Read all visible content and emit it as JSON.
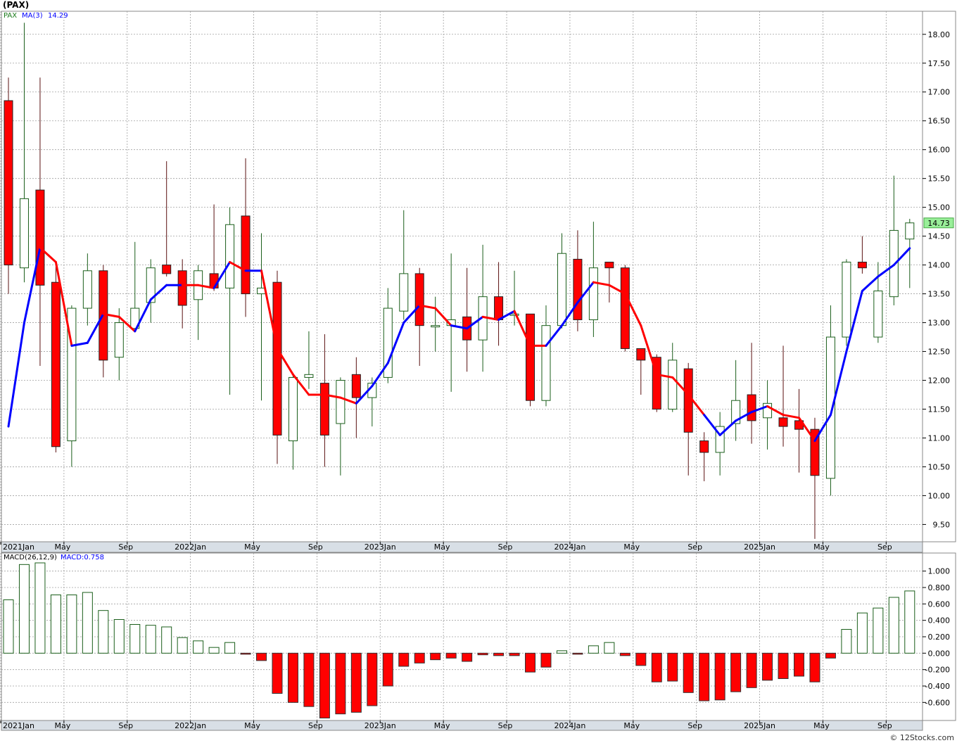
{
  "title": "(PAX)",
  "credit": "© 12Stocks.com",
  "price_legend": {
    "symbol": "PAX",
    "ma_label": "MA(3)",
    "ma_value": "14.29"
  },
  "macd_legend": {
    "label": "MACD(26,12,9)",
    "value_label": "MACD:0.758"
  },
  "last_price_label": "14.73",
  "colors": {
    "up_body_stroke": "#1a5e1a",
    "down_body": "#ff0000",
    "ma_up": "#0000ff",
    "ma_down": "#ff0000",
    "grid": "#a0a0a0",
    "axis_band": "#d8dfe6",
    "last_price_bg": "#99ee99"
  },
  "x_axis_labels": [
    "2021Jan",
    "May",
    "Sep",
    "2022Jan",
    "May",
    "Sep",
    "2023Jan",
    "May",
    "Sep",
    "2024Jan",
    "May",
    "Sep",
    "2025Jan",
    "May",
    "Sep"
  ],
  "price_axis": {
    "ticks": [
      "18.00",
      "17.50",
      "17.00",
      "16.50",
      "16.00",
      "15.50",
      "15.00",
      "14.50",
      "14.00",
      "13.50",
      "13.00",
      "12.50",
      "12.00",
      "11.50",
      "11.00",
      "10.50",
      "10.00",
      "9.50"
    ],
    "min": 9.2,
    "max": 18.4
  },
  "macd_axis": {
    "ticks": [
      "1.000",
      "0.800",
      "0.600",
      "0.400",
      "0.200",
      "0.000",
      "-0.200",
      "-0.400",
      "-0.600"
    ],
    "min": -0.82,
    "max": 1.22
  },
  "chart_data": [
    {
      "type": "candlestick",
      "title": "(PAX)",
      "x_labels": [
        "2021Jan",
        "May",
        "Sep",
        "2022Jan",
        "May",
        "Sep",
        "2023Jan",
        "May",
        "Sep",
        "2024Jan",
        "May",
        "Sep",
        "2025Jan",
        "May",
        "Sep"
      ],
      "ylim": [
        9.2,
        18.4
      ],
      "candles": [
        {
          "o": 16.85,
          "h": 17.25,
          "l": 13.5,
          "c": 14.0
        },
        {
          "o": 13.95,
          "h": 18.2,
          "l": 13.7,
          "c": 15.15
        },
        {
          "o": 15.3,
          "h": 17.25,
          "l": 12.25,
          "c": 13.65
        },
        {
          "o": 13.7,
          "h": 14.05,
          "l": 10.75,
          "c": 10.85
        },
        {
          "o": 10.95,
          "h": 13.3,
          "l": 10.5,
          "c": 13.25
        },
        {
          "o": 13.25,
          "h": 14.2,
          "l": 12.95,
          "c": 13.9
        },
        {
          "o": 13.9,
          "h": 14.0,
          "l": 12.05,
          "c": 12.35
        },
        {
          "o": 12.4,
          "h": 13.25,
          "l": 12.0,
          "c": 13.0
        },
        {
          "o": 12.9,
          "h": 14.4,
          "l": 12.85,
          "c": 13.25
        },
        {
          "o": 13.35,
          "h": 14.1,
          "l": 13.0,
          "c": 13.95
        },
        {
          "o": 14.0,
          "h": 15.8,
          "l": 13.8,
          "c": 13.85
        },
        {
          "o": 13.9,
          "h": 14.1,
          "l": 12.9,
          "c": 13.3
        },
        {
          "o": 13.4,
          "h": 14.0,
          "l": 12.7,
          "c": 13.9
        },
        {
          "o": 13.85,
          "h": 15.05,
          "l": 13.55,
          "c": 13.6
        },
        {
          "o": 13.6,
          "h": 15.0,
          "l": 11.75,
          "c": 14.7
        },
        {
          "o": 14.85,
          "h": 15.85,
          "l": 13.1,
          "c": 13.5
        },
        {
          "o": 13.5,
          "h": 14.55,
          "l": 11.65,
          "c": 13.6
        },
        {
          "o": 13.7,
          "h": 13.9,
          "l": 10.55,
          "c": 11.05
        },
        {
          "o": 10.95,
          "h": 12.1,
          "l": 10.45,
          "c": 12.05
        },
        {
          "o": 12.05,
          "h": 12.85,
          "l": 11.85,
          "c": 12.1
        },
        {
          "o": 11.95,
          "h": 12.8,
          "l": 10.5,
          "c": 11.05
        },
        {
          "o": 11.25,
          "h": 12.05,
          "l": 10.35,
          "c": 12.0
        },
        {
          "o": 12.1,
          "h": 12.4,
          "l": 11.0,
          "c": 11.7
        },
        {
          "o": 11.7,
          "h": 12.05,
          "l": 11.2,
          "c": 11.95
        },
        {
          "o": 12.05,
          "h": 13.6,
          "l": 11.95,
          "c": 13.25
        },
        {
          "o": 13.2,
          "h": 14.95,
          "l": 13.05,
          "c": 13.85
        },
        {
          "o": 13.85,
          "h": 13.95,
          "l": 12.25,
          "c": 12.95
        },
        {
          "o": 12.95,
          "h": 13.45,
          "l": 12.5,
          "c": 12.95
        },
        {
          "o": 12.95,
          "h": 14.2,
          "l": 11.8,
          "c": 13.05
        },
        {
          "o": 13.1,
          "h": 13.95,
          "l": 12.15,
          "c": 12.7
        },
        {
          "o": 12.7,
          "h": 14.35,
          "l": 12.15,
          "c": 13.45
        },
        {
          "o": 13.45,
          "h": 14.05,
          "l": 12.6,
          "c": 13.05
        },
        {
          "o": 13.15,
          "h": 13.9,
          "l": 12.95,
          "c": 13.15
        },
        {
          "o": 13.15,
          "h": 13.15,
          "l": 11.55,
          "c": 11.65
        },
        {
          "o": 11.65,
          "h": 13.3,
          "l": 11.55,
          "c": 12.95
        },
        {
          "o": 12.95,
          "h": 14.55,
          "l": 12.9,
          "c": 14.2
        },
        {
          "o": 14.1,
          "h": 14.6,
          "l": 12.85,
          "c": 13.05
        },
        {
          "o": 13.05,
          "h": 14.75,
          "l": 12.75,
          "c": 13.95
        },
        {
          "o": 14.05,
          "h": 14.05,
          "l": 13.35,
          "c": 13.95
        },
        {
          "o": 13.95,
          "h": 14.0,
          "l": 12.5,
          "c": 12.55
        },
        {
          "o": 12.55,
          "h": 12.5,
          "l": 11.75,
          "c": 12.35
        },
        {
          "o": 12.4,
          "h": 12.45,
          "l": 11.45,
          "c": 11.5
        },
        {
          "o": 11.5,
          "h": 12.65,
          "l": 11.45,
          "c": 12.35
        },
        {
          "o": 12.2,
          "h": 12.3,
          "l": 10.35,
          "c": 11.1
        },
        {
          "o": 10.95,
          "h": 11.1,
          "l": 10.25,
          "c": 10.75
        },
        {
          "o": 10.75,
          "h": 11.45,
          "l": 10.35,
          "c": 11.2
        },
        {
          "o": 11.25,
          "h": 12.35,
          "l": 10.95,
          "c": 11.65
        },
        {
          "o": 11.75,
          "h": 12.65,
          "l": 10.9,
          "c": 11.3
        },
        {
          "o": 11.35,
          "h": 12.0,
          "l": 10.8,
          "c": 11.6
        },
        {
          "o": 11.35,
          "h": 12.6,
          "l": 10.85,
          "c": 11.2
        },
        {
          "o": 11.3,
          "h": 11.85,
          "l": 10.4,
          "c": 11.15
        },
        {
          "o": 11.15,
          "h": 11.35,
          "l": 9.25,
          "c": 10.35
        },
        {
          "o": 10.3,
          "h": 13.3,
          "l": 10.0,
          "c": 12.75
        },
        {
          "o": 12.75,
          "h": 14.1,
          "l": 12.6,
          "c": 14.05
        },
        {
          "o": 14.05,
          "h": 14.5,
          "l": 13.85,
          "c": 13.95
        },
        {
          "o": 12.75,
          "h": 14.05,
          "l": 12.65,
          "c": 13.55
        },
        {
          "o": 13.45,
          "h": 15.55,
          "l": 13.3,
          "c": 14.6
        },
        {
          "o": 14.45,
          "h": 14.8,
          "l": 13.6,
          "c": 14.73
        }
      ]
    },
    {
      "type": "line",
      "name": "MA(3)",
      "values": [
        11.2,
        13.0,
        14.3,
        14.05,
        12.6,
        12.65,
        13.15,
        13.1,
        12.85,
        13.4,
        13.65,
        13.65,
        13.65,
        13.6,
        14.05,
        13.9,
        13.9,
        12.55,
        12.1,
        11.75,
        11.75,
        11.7,
        11.6,
        11.9,
        12.3,
        13.0,
        13.3,
        13.25,
        12.95,
        12.9,
        13.1,
        13.05,
        13.2,
        12.6,
        12.6,
        12.95,
        13.35,
        13.7,
        13.65,
        13.5,
        12.95,
        12.1,
        12.05,
        11.75,
        11.4,
        11.05,
        11.3,
        11.45,
        11.55,
        11.4,
        11.35,
        10.95,
        11.4,
        12.5,
        13.55,
        13.8,
        14.0,
        14.29
      ],
      "direction": [
        "u",
        "u",
        "u",
        "d",
        "d",
        "u",
        "u",
        "d",
        "d",
        "u",
        "u",
        "u",
        "d",
        "d",
        "u",
        "d",
        "u",
        "d",
        "d",
        "d",
        "d",
        "d",
        "d",
        "u",
        "u",
        "u",
        "u",
        "d",
        "d",
        "u",
        "u",
        "d",
        "u",
        "d",
        "d",
        "u",
        "u",
        "u",
        "d",
        "d",
        "d",
        "d",
        "d",
        "d",
        "d",
        "u",
        "u",
        "u",
        "u",
        "d",
        "d",
        "d",
        "u",
        "u",
        "u",
        "u",
        "u",
        "u"
      ]
    },
    {
      "type": "bar",
      "name": "MACD(26,12,9)",
      "ylim": [
        -0.82,
        1.22
      ],
      "values": [
        0.65,
        1.08,
        1.1,
        0.71,
        0.71,
        0.74,
        0.52,
        0.41,
        0.35,
        0.34,
        0.32,
        0.19,
        0.15,
        0.07,
        0.13,
        -0.01,
        -0.09,
        -0.49,
        -0.6,
        -0.65,
        -0.79,
        -0.74,
        -0.72,
        -0.64,
        -0.4,
        -0.16,
        -0.12,
        -0.08,
        -0.06,
        -0.1,
        -0.02,
        -0.03,
        -0.03,
        -0.23,
        -0.17,
        0.03,
        -0.01,
        0.09,
        0.13,
        -0.03,
        -0.15,
        -0.35,
        -0.34,
        -0.48,
        -0.58,
        -0.57,
        -0.47,
        -0.42,
        -0.33,
        -0.31,
        -0.28,
        -0.35,
        -0.06,
        0.29,
        0.49,
        0.55,
        0.68,
        0.758
      ]
    }
  ]
}
